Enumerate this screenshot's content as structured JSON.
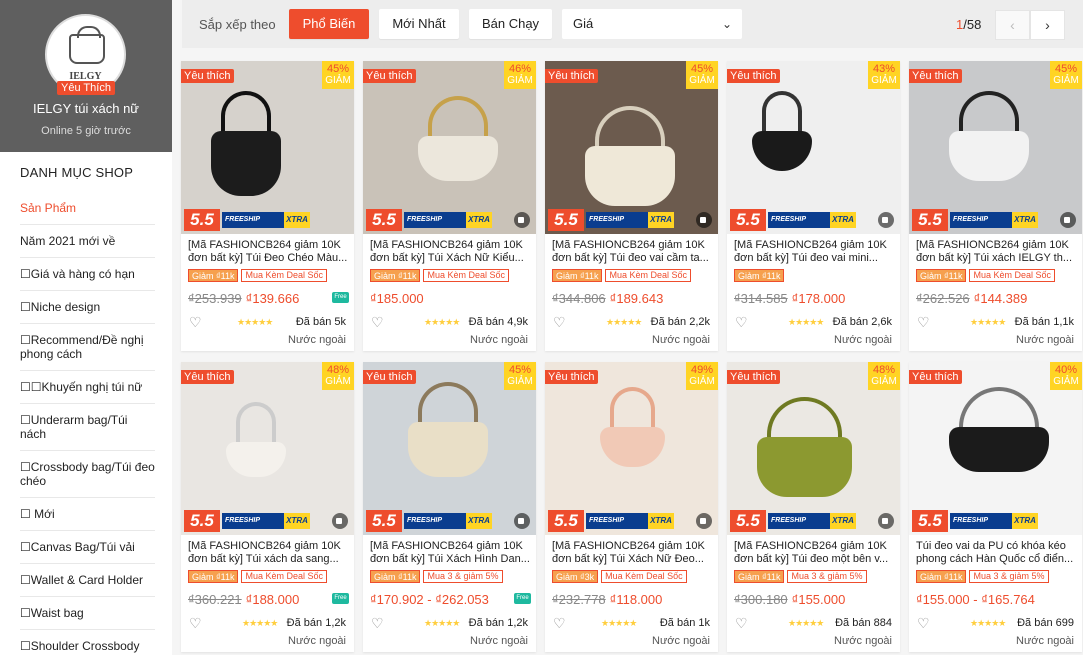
{
  "shop": {
    "logo_text": "IELGY",
    "favorite_badge": "Yêu Thích",
    "name": "IELGY túi xách nữ",
    "status": "Online 5 giờ trước"
  },
  "categories": {
    "title": "DANH MỤC SHOP",
    "items": [
      "Sản Phẩm",
      "Năm 2021 mới về",
      "☐Giá và hàng có hạn",
      "☐Niche design",
      "☐Recommend/Đề nghị phong cách",
      "☐☐Khuyến nghị túi nữ",
      "☐Underarm bag/Túi nách",
      "☐Crossbody bag/Túi đeo chéo",
      "☐ Mới",
      "☐Canvas Bag/Túi vải",
      "☐Wallet & Card Holder",
      "☐Waist bag",
      "☐Shoulder Crossbody"
    ]
  },
  "sort": {
    "label": "Sắp xếp theo",
    "options": [
      "Phổ Biến",
      "Mới Nhất",
      "Bán Chạy"
    ],
    "price_select": "Giá",
    "page_current": "1",
    "page_total": "/58"
  },
  "common": {
    "fav_tag": "Yêu thích",
    "discount_sub": "GIẢM",
    "promo_big": "5.5",
    "promo_ship": "FREESHIP",
    "promo_xtra": "XTRA",
    "freeship_badge": "Free",
    "origin": "Nước ngoài",
    "heart": "♡",
    "stars": "★★★★★"
  },
  "colors": {
    "accent": "#ee4d2d",
    "sidebar_header": "#5f5f5f",
    "discount_bg": "#ffd424"
  },
  "products": [
    {
      "title": "[Mã FASHIONCB264 giảm 10K đơn bất kỳ] Túi Đeo Chéo Màu...",
      "discount": "45%",
      "voucher": "Giảm ₫11k",
      "deal": "Mua Kèm Deal Sốc",
      "old_price": "₫253.939",
      "price": "₫139.666",
      "sold": "Đã bán 5k"
    },
    {
      "title": "[Mã FASHIONCB264 giảm 10K đơn bất kỳ] Túi Xách Nữ Kiểu...",
      "discount": "46%",
      "voucher": "Giảm ₫11k",
      "deal": "Mua Kèm Deal Sốc",
      "old_price": "",
      "price": "₫185.000",
      "sold": "Đã bán 4,9k"
    },
    {
      "title": "[Mã FASHIONCB264 giảm 10K đơn bất kỳ] Túi đeo vai cầm ta...",
      "discount": "45%",
      "voucher": "Giảm ₫11k",
      "deal": "Mua Kèm Deal Sốc",
      "old_price": "₫344.806",
      "price": "₫189.643",
      "sold": "Đã bán 2,2k"
    },
    {
      "title": "[Mã FASHIONCB264 giảm 10K đơn bất kỳ] Túi đeo vai mini...",
      "discount": "43%",
      "voucher": "Giảm ₫11k",
      "deal": "",
      "old_price": "₫314.585",
      "price": "₫178.000",
      "sold": "Đã bán 2,6k"
    },
    {
      "title": "[Mã FASHIONCB264 giảm 10K đơn bất kỳ] Túi xách IELGY th...",
      "discount": "45%",
      "voucher": "Giảm ₫11k",
      "deal": "Mua Kèm Deal Sốc",
      "old_price": "₫262.526",
      "price": "₫144.389",
      "sold": "Đã bán 1,1k"
    },
    {
      "title": "[Mã FASHIONCB264 giảm 10K đơn bất kỳ] Túi xách da sang...",
      "discount": "48%",
      "voucher": "Giảm ₫11k",
      "deal": "Mua Kèm Deal Sốc",
      "old_price": "₫360.221",
      "price": "₫188.000",
      "sold": "Đã bán 1,2k"
    },
    {
      "title": "[Mã FASHIONCB264 giảm 10K đơn bất kỳ] Túi Xách Hình Dan...",
      "discount": "45%",
      "voucher": "Giảm ₫11k",
      "deal": "Mua 3 & giảm 5%",
      "old_price": "",
      "price": "₫170.902 - ₫262.053",
      "sold": "Đã bán 1,2k"
    },
    {
      "title": "[Mã FASHIONCB264 giảm 10K đơn bất kỳ] Túi Xách Nữ Đeo...",
      "discount": "49%",
      "voucher": "Giảm ₫3k",
      "deal": "Mua Kèm Deal Sốc",
      "old_price": "₫232.778",
      "price": "₫118.000",
      "sold": "Đã bán 1k"
    },
    {
      "title": "[Mã FASHIONCB264 giảm 10K đơn bất kỳ] Túi đeo một bên v...",
      "discount": "48%",
      "voucher": "Giảm ₫11k",
      "deal": "Mua 3 & giảm 5%",
      "old_price": "₫300.180",
      "price": "₫155.000",
      "sold": "Đã bán 884"
    },
    {
      "title": "Túi đeo vai da PU có khóa kéo phong cách Hàn Quốc cổ điển...",
      "discount": "40%",
      "voucher": "Giảm ₫11k",
      "deal": "Mua 3 & giảm 5%",
      "old_price": "",
      "price": "₫155.000 - ₫165.764",
      "sold": "Đã bán 699"
    }
  ]
}
